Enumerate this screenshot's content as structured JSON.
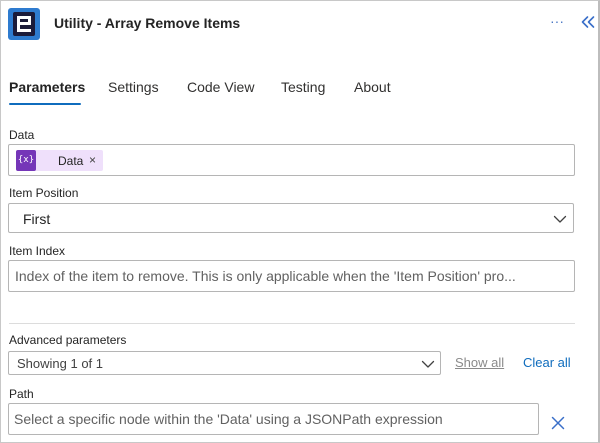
{
  "header": {
    "title": "Utility - Array Remove Items",
    "more_label": "···",
    "app_icon": "encodian-logo-icon",
    "collapse_icon": "double-chevron-left-icon",
    "accent_color": "#2e7bcf"
  },
  "tabs": [
    {
      "label": "Parameters",
      "active": true
    },
    {
      "label": "Settings"
    },
    {
      "label": "Code View"
    },
    {
      "label": "Testing"
    },
    {
      "label": "About"
    }
  ],
  "fields": {
    "data": {
      "label": "Data",
      "token": {
        "label": "Data",
        "icon_text": "{x}",
        "remove_label": "×",
        "color": "#7536b8"
      }
    },
    "item_position": {
      "label": "Item Position",
      "value": "First"
    },
    "item_index": {
      "label": "Item Index",
      "placeholder": "Index of the item to remove. This is only applicable when the 'Item Position' pro..."
    }
  },
  "advanced": {
    "label": "Advanced parameters",
    "select_value": "Showing 1 of 1",
    "show_all": "Show all",
    "clear_all": "Clear all"
  },
  "path": {
    "label": "Path",
    "placeholder": "Select a specific node within the 'Data' using a JSONPath expression"
  }
}
